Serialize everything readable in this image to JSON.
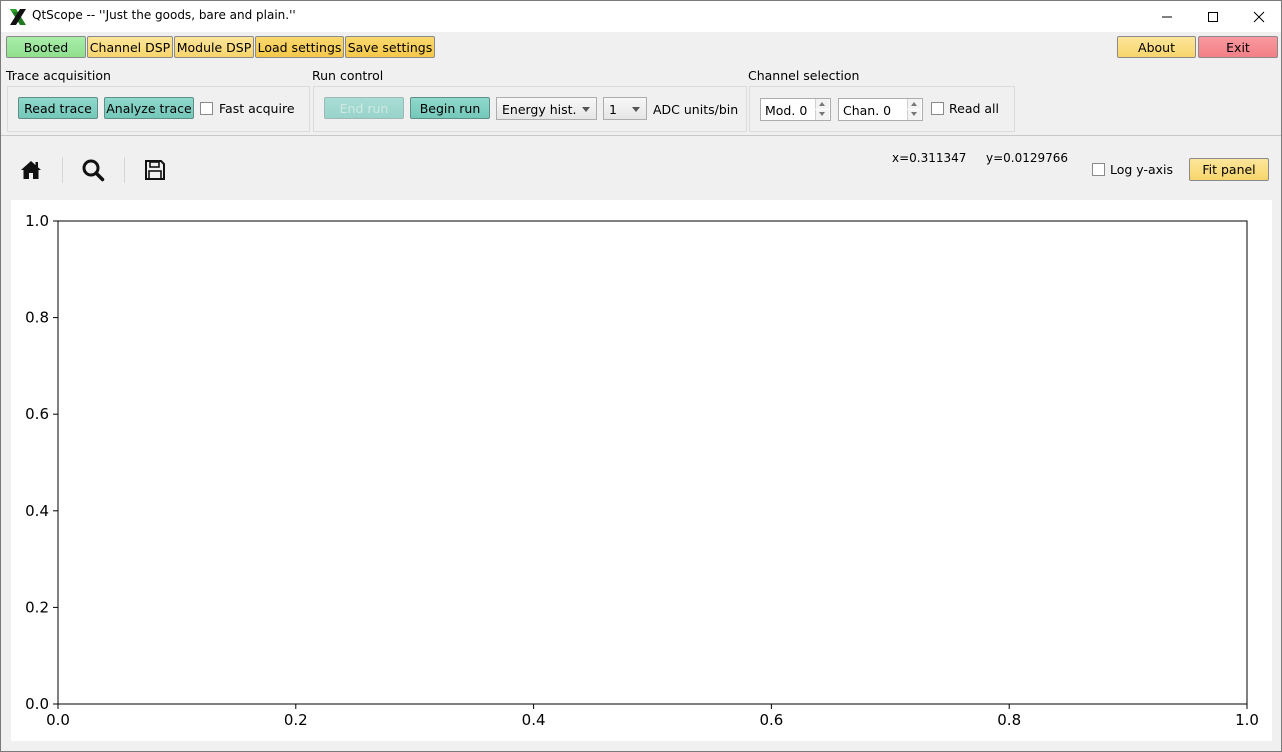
{
  "window": {
    "title": "QtScope -- ''Just the goods, bare and plain.''"
  },
  "topbar": {
    "booted": "Booted",
    "channel_dsp": "Channel DSP",
    "module_dsp": "Module DSP",
    "load_settings": "Load settings",
    "save_settings": "Save settings",
    "about": "About",
    "exit": "Exit"
  },
  "trace_acquisition": {
    "label": "Trace acquisition",
    "read_trace": "Read trace",
    "analyze_trace": "Analyze trace",
    "fast_acquire": "Fast acquire"
  },
  "run_control": {
    "label": "Run control",
    "end_run": "End run",
    "begin_run": "Begin run",
    "run_type": "Energy hist.",
    "bin_size": "1",
    "bin_units": "ADC units/bin"
  },
  "channel_selection": {
    "label": "Channel selection",
    "module": "Mod. 0",
    "channel": "Chan. 0",
    "read_all": "Read all"
  },
  "toolbar": {
    "icons": [
      "home-icon",
      "zoom-icon",
      "save-icon"
    ],
    "x_readout": "x=0.311347",
    "y_readout": "y=0.0129766",
    "log_y": "Log y-axis",
    "fit_panel": "Fit panel"
  },
  "chart_data": {
    "type": "line",
    "series": [],
    "xlim": [
      0.0,
      1.0
    ],
    "ylim": [
      0.0,
      1.0
    ],
    "x_ticks": [
      "0.0",
      "0.2",
      "0.4",
      "0.6",
      "0.8",
      "1.0"
    ],
    "y_ticks": [
      "0.0",
      "0.2",
      "0.4",
      "0.6",
      "0.8",
      "1.0"
    ],
    "grid": false,
    "log_y": false
  }
}
